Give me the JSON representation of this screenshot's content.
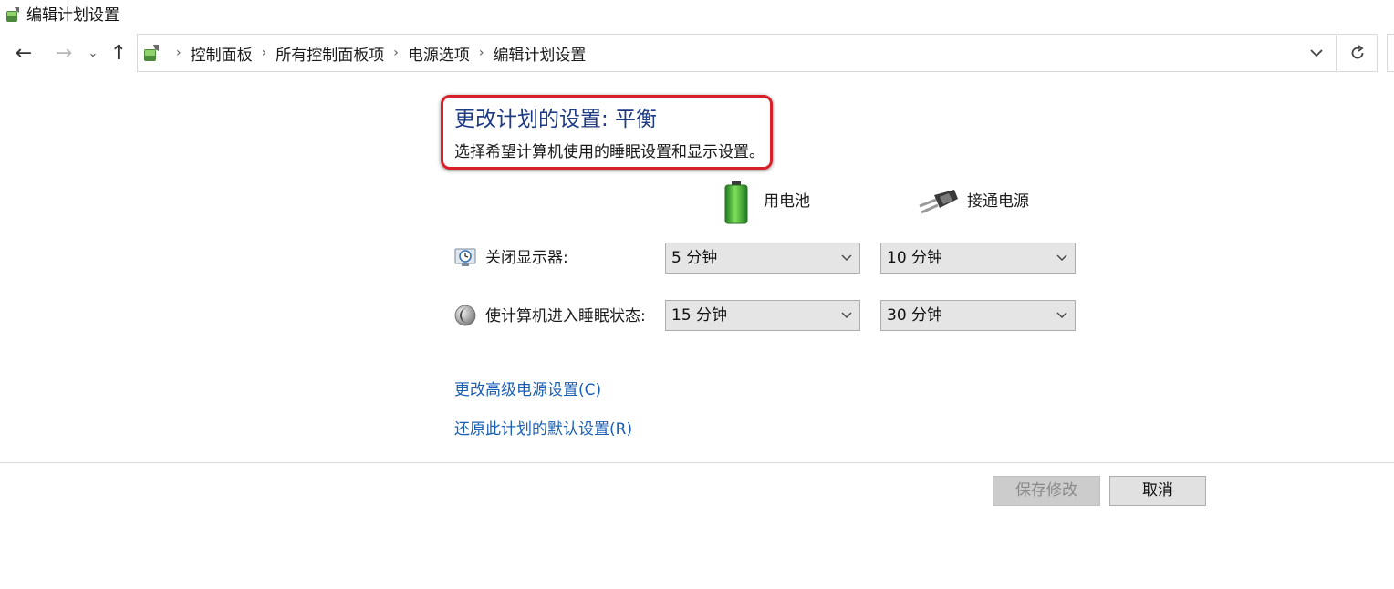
{
  "window": {
    "title": "编辑计划设置"
  },
  "nav": {
    "back": "←",
    "forward": "→",
    "recent": "⌄",
    "up": "↑"
  },
  "breadcrumbs": [
    "控制面板",
    "所有控制面板项",
    "电源选项",
    "编辑计划设置"
  ],
  "heading": {
    "title": "更改计划的设置: 平衡",
    "subtitle": "选择希望计算机使用的睡眠设置和显示设置。",
    "highlight_color": "#d9202a"
  },
  "columns": {
    "battery": "用电池",
    "plugged_in": "接通电源"
  },
  "settings": [
    {
      "label": "关闭显示器:",
      "icon": "display-clock-icon",
      "battery": "5 分钟",
      "plugged": "10 分钟"
    },
    {
      "label": "使计算机进入睡眠状态:",
      "icon": "moon-sleep-icon",
      "battery": "15 分钟",
      "plugged": "30 分钟"
    }
  ],
  "links": {
    "advanced": "更改高级电源设置(C)",
    "restore": "还原此计划的默认设置(R)"
  },
  "buttons": {
    "save": "保存修改",
    "cancel": "取消"
  },
  "colors": {
    "title": "#1f3b83",
    "link": "#1a5fb4",
    "battery": "#3cb043"
  }
}
